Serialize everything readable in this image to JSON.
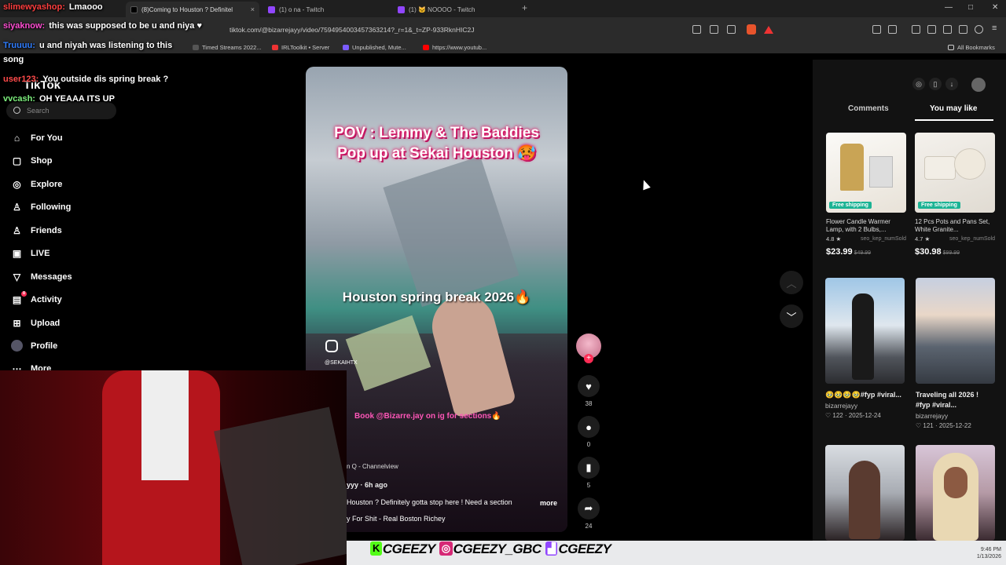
{
  "browser": {
    "tabs": [
      {
        "label": "(8)Coming to Houston ? Definitel",
        "close": "×"
      },
      {
        "label": "(1) o na - Twitch"
      },
      {
        "label": "(1) 🐱 NOOOO - Twitch"
      }
    ],
    "new_tab": "+",
    "window_controls": [
      "—",
      "□",
      "✕"
    ],
    "url": "tiktok.com/@bizarrejayy/video/7594954003457363214?_r=1&_t=ZP-933RknHIC2J",
    "bookmarks": [
      "Timed Streams 2022...",
      "IRLToolkit • Server",
      "Unpublished, Mute...",
      "https://www.youtub..."
    ],
    "all_bookmarks": "All Bookmarks"
  },
  "tiktok": {
    "logo": "TikTok",
    "search_placeholder": "Search",
    "nav": [
      "For You",
      "Shop",
      "Explore",
      "Following",
      "Friends",
      "LIVE",
      "Messages",
      "Activity",
      "Upload",
      "Profile",
      "More"
    ],
    "activity_badge": "8"
  },
  "video": {
    "caption1_line1": "POV : Lemmy & The Baddies",
    "caption1_line2": "Pop up at Sekai Houston 🥵",
    "caption2": "Houston spring break 2026🔥",
    "book": "Book @Bizarre.jay on ig for sections🔥",
    "watermark": "@SEKAIHTX",
    "location": "n Q - Channelview",
    "author": "yyy · 6h ago",
    "description": "Houston ? Definitely gotta stop here ! Need a section",
    "more": "more",
    "song": "y For Shit - Real Boston Richey",
    "counts": {
      "likes": "38",
      "comments": "0",
      "saves": "5",
      "shares": "24"
    }
  },
  "side_panel": {
    "tabs": [
      "Comments",
      "You may like"
    ],
    "products": [
      {
        "badge": "Free shipping",
        "title": "Flower Candle Warmer Lamp, with 2 Bulbs,...",
        "rating": "4.8 ★",
        "sold": "seo_kep_numSold",
        "price": "$23.99",
        "old_price": "$49.99"
      },
      {
        "badge": "Free shipping",
        "title": "12 Pcs Pots and Pans Set, White Granite...",
        "rating": "4.7 ★",
        "sold": "seo_kep_numSold",
        "price": "$30.98",
        "old_price": "$99.99"
      }
    ],
    "videos": [
      {
        "title": "🥹🥹🥹🥹#fyp #viral...",
        "author": "bizarrejayy",
        "stats": "♡ 122 · 2025-12-24"
      },
      {
        "title": "Traveling all 2026 ! #fyp #viral...",
        "author": "bizarrejayy",
        "stats": "♡ 121 · 2025-12-22"
      }
    ]
  },
  "chat": [
    {
      "user": "slimewyashop:",
      "text": "Lmaooo",
      "color": "#ff3e3e"
    },
    {
      "user": "siyaknow:",
      "text": "this was supposed to be u and niya ♥",
      "color": "#ff4dd2"
    },
    {
      "user": "Truuuu:",
      "text": "u and niyah was listening to this",
      "color": "#2f7dff"
    },
    {
      "user": "",
      "text": "song",
      "color": "#ffffff"
    },
    {
      "user": "user123:",
      "text": "You outside dis spring break ?",
      "color": "#ff4a4a"
    },
    {
      "user": "vvcash:",
      "text": "OH YEAAA ITS UP",
      "color": "#7df07d"
    }
  ],
  "banner": {
    "handles": [
      "CGEEZY",
      "CGEEZY_GBC",
      "CGEEZY"
    ],
    "time": "9:46 PM",
    "date": "1/13/2026"
  },
  "colors": {
    "tiktok_red": "#fe2c55",
    "free_shipping": "#1bb394",
    "twitch": "#9146ff"
  }
}
